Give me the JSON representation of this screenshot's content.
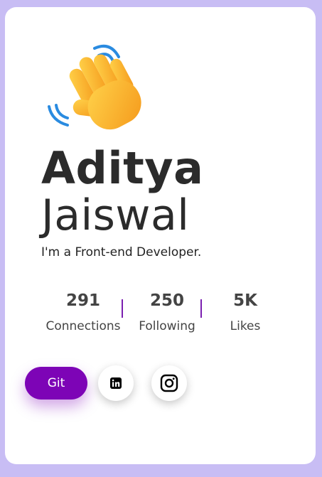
{
  "profile": {
    "first_name": "Aditya",
    "last_name": "Jaiswal",
    "tagline": "I'm a Front-end Developer."
  },
  "stats": [
    {
      "value": "291",
      "label": "Connections"
    },
    {
      "value": "250",
      "label": "Following"
    },
    {
      "value": "5K",
      "label": "Likes"
    }
  ],
  "actions": {
    "git_label": "Git",
    "linkedin_icon": "linkedin-icon",
    "instagram_icon": "instagram-icon"
  },
  "colors": {
    "background": "#c8bdf4",
    "accent": "#7d04b6",
    "divider": "#7a1fb0",
    "text": "#2b2b2b"
  }
}
